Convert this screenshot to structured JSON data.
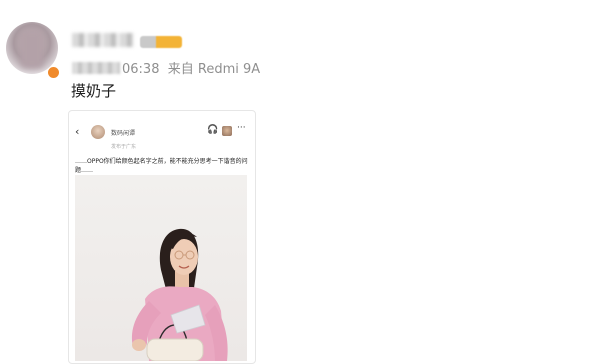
{
  "post": {
    "meta_time": "06:38",
    "meta_source": "来自 Redmi 9A",
    "text": "摸奶子"
  },
  "embedded_screenshot": {
    "back_glyph": "‹",
    "account_name": "数码闲谭",
    "sub_text": "发布于广东",
    "header_icons": [
      "headphones-icon",
      "thumbnail-avatar-icon",
      "more-icon"
    ],
    "headphones_glyph": "🎧",
    "more_glyph": "···",
    "caption": "……OPPO你们给颜色起名字之前，能不能充分思考一下谐音的问题……"
  },
  "colors": {
    "meta_gray": "#8f8f8f",
    "badge_orange": "#f08a2b",
    "blouse_pink": "#eaa9c2",
    "bag_cream": "#f3ece1"
  }
}
